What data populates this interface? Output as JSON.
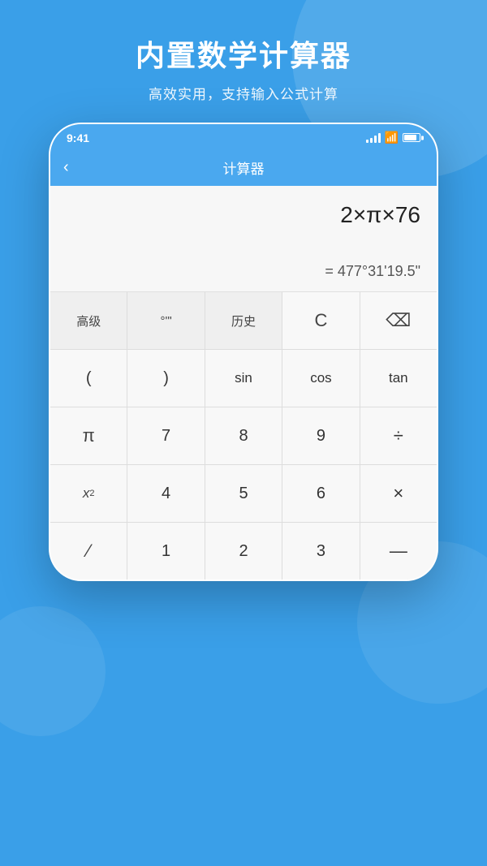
{
  "background_color": "#3a9fe8",
  "header": {
    "title": "内置数学计算器",
    "subtitle": "高效实用，支持输入公式计算"
  },
  "status_bar": {
    "time": "9:41",
    "signal_bars": 4,
    "wifi": true,
    "battery": 85
  },
  "app_header": {
    "back_label": "‹",
    "title": "计算器"
  },
  "calculator": {
    "input": "2×π×76",
    "result": "= 477°31'19.5\""
  },
  "keypad": {
    "rows": [
      [
        {
          "label": "高级",
          "type": "gray"
        },
        {
          "label": "°'\"",
          "type": "gray"
        },
        {
          "label": "历史",
          "type": "gray"
        },
        {
          "label": "C",
          "type": "clear"
        },
        {
          "label": "⌫",
          "type": "backspace"
        }
      ],
      [
        {
          "label": "(",
          "type": "normal"
        },
        {
          "label": ")",
          "type": "normal"
        },
        {
          "label": "sin",
          "type": "trig"
        },
        {
          "label": "cos",
          "type": "trig"
        },
        {
          "label": "tan",
          "type": "trig"
        }
      ],
      [
        {
          "label": "π",
          "type": "special"
        },
        {
          "label": "7",
          "type": "number"
        },
        {
          "label": "8",
          "type": "number"
        },
        {
          "label": "9",
          "type": "number"
        },
        {
          "label": "÷",
          "type": "operator"
        }
      ],
      [
        {
          "label": "x²",
          "type": "special"
        },
        {
          "label": "4",
          "type": "number"
        },
        {
          "label": "5",
          "type": "number"
        },
        {
          "label": "6",
          "type": "number"
        },
        {
          "label": "×",
          "type": "operator"
        }
      ],
      [
        {
          "label": "/",
          "type": "special"
        },
        {
          "label": "1",
          "type": "number"
        },
        {
          "label": "2",
          "type": "number"
        },
        {
          "label": "3",
          "type": "number"
        },
        {
          "label": "—",
          "type": "operator"
        }
      ]
    ]
  }
}
